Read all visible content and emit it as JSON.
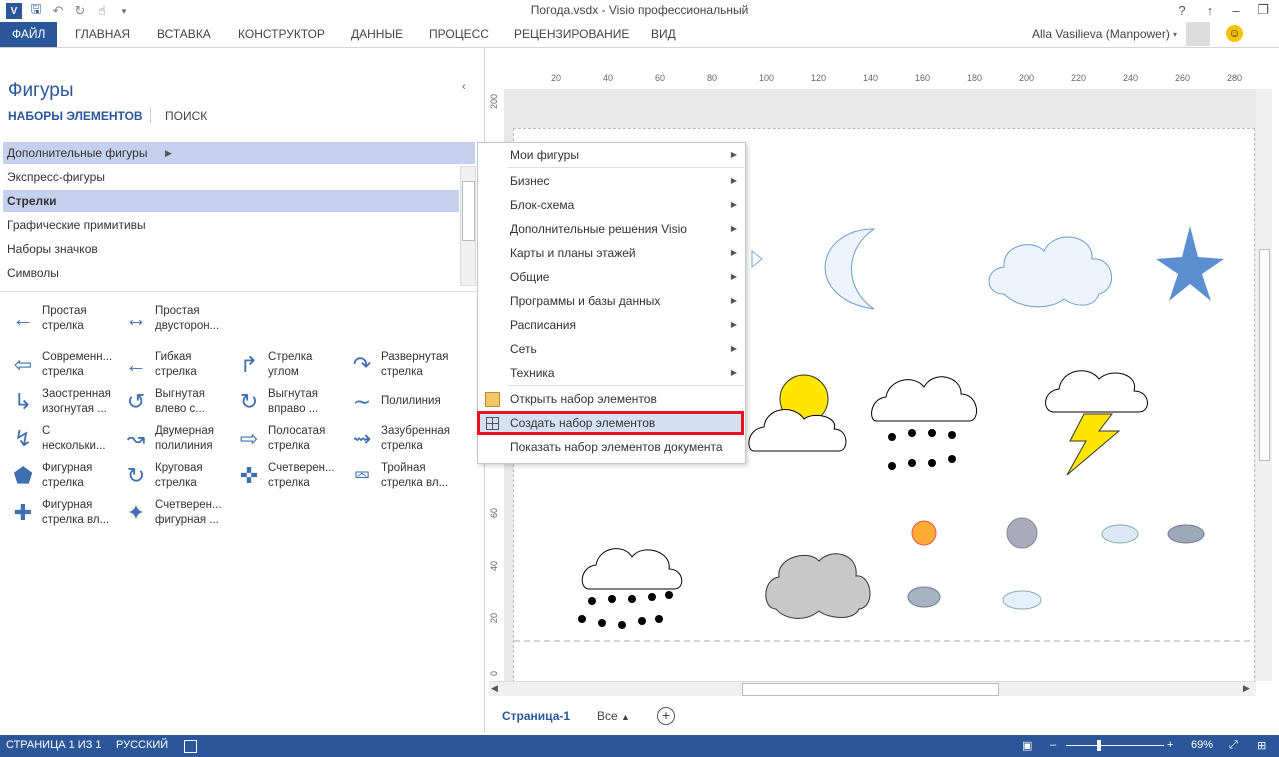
{
  "window": {
    "title": "Погода.vsdx -  Visio профессиональный",
    "user": "Alla Vasilieva (Manpower)"
  },
  "ribbon": {
    "tabs": [
      "ФАЙЛ",
      "ГЛАВНАЯ",
      "ВСТАВКА",
      "КОНСТРУКТОР",
      "ДАННЫЕ",
      "ПРОЦЕСС",
      "РЕЦЕНЗИРОВАНИЕ",
      "ВИД"
    ]
  },
  "shapes_pane": {
    "title": "Фигуры",
    "tab_sets": "НАБОРЫ ЭЛЕМЕНТОВ",
    "tab_search": "ПОИСК",
    "stencils": [
      "Дополнительные фигуры",
      "Экспресс-фигуры",
      "Стрелки",
      "Графические примитивы",
      "Наборы значков",
      "Символы"
    ],
    "shapes": [
      [
        "Простая",
        "стрелка"
      ],
      [
        "Простая",
        "двусторон..."
      ],
      [
        "Современн...",
        "стрелка"
      ],
      [
        "Гибкая",
        "стрелка"
      ],
      [
        "Стрелка",
        "углом"
      ],
      [
        "Развернутая",
        "стрелка"
      ],
      [
        "Заостренная",
        "изогнутая ..."
      ],
      [
        "Выгнутая",
        "влево с..."
      ],
      [
        "Выгнутая",
        "вправо ..."
      ],
      [
        "Полилиния",
        ""
      ],
      [
        "С",
        "нескольки..."
      ],
      [
        "Двумерная",
        "полилиния"
      ],
      [
        "Полосатая",
        "стрелка"
      ],
      [
        "Зазубренная",
        "стрелка"
      ],
      [
        "Фигурная",
        "стрелка"
      ],
      [
        "Круговая",
        "стрелка"
      ],
      [
        "Счетверен...",
        "стрелка"
      ],
      [
        "Тройная",
        "стрелка вл..."
      ],
      [
        "Фигурная",
        "стрелка вл..."
      ],
      [
        "Счетверен...",
        "фигурная ..."
      ]
    ]
  },
  "menu": {
    "items": [
      "Мои фигуры",
      "Бизнес",
      "Блок-схема",
      "Дополнительные решения Visio",
      "Карты и планы этажей",
      "Общие",
      "Программы и базы данных",
      "Расписания",
      "Сеть",
      "Техника"
    ],
    "open": "Открыть набор элементов",
    "create": "Создать набор элементов",
    "show": "Показать набор элементов документа"
  },
  "ruler": {
    "top": [
      "20",
      "40",
      "60",
      "80",
      "100",
      "120",
      "140",
      "160",
      "180",
      "200",
      "220",
      "240",
      "260",
      "280"
    ],
    "left": [
      "200",
      "60",
      "40",
      "20",
      "0"
    ]
  },
  "page_tabs": {
    "current": "Страница-1",
    "all": "Все"
  },
  "status": {
    "page": "СТРАНИЦА 1 ИЗ 1",
    "lang": "РУССКИЙ",
    "zoom": "69%"
  },
  "colors": {
    "accent": "#2b579a",
    "highlight": "#e81123",
    "selected": "#c5d0ee"
  }
}
